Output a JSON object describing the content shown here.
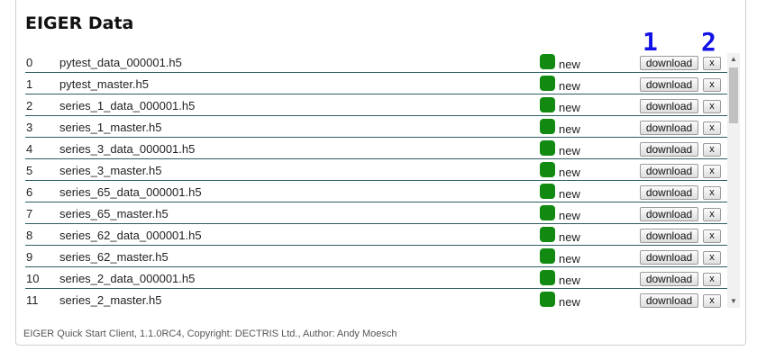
{
  "title": "EIGER Data",
  "markers": [
    "1",
    "2"
  ],
  "buttons": {
    "download_label": "download",
    "delete_label": "x"
  },
  "colors": {
    "status_new": "#128a12",
    "marker": "#1212e8",
    "row_divider": "#2f5d63"
  },
  "files": [
    {
      "index": "0",
      "name": "pytest_data_000001.h5",
      "status": "new"
    },
    {
      "index": "1",
      "name": "pytest_master.h5",
      "status": "new"
    },
    {
      "index": "2",
      "name": "series_1_data_000001.h5",
      "status": "new"
    },
    {
      "index": "3",
      "name": "series_1_master.h5",
      "status": "new"
    },
    {
      "index": "4",
      "name": "series_3_data_000001.h5",
      "status": "new"
    },
    {
      "index": "5",
      "name": "series_3_master.h5",
      "status": "new"
    },
    {
      "index": "6",
      "name": "series_65_data_000001.h5",
      "status": "new"
    },
    {
      "index": "7",
      "name": "series_65_master.h5",
      "status": "new"
    },
    {
      "index": "8",
      "name": "series_62_data_000001.h5",
      "status": "new"
    },
    {
      "index": "9",
      "name": "series_62_master.h5",
      "status": "new"
    },
    {
      "index": "10",
      "name": "series_2_data_000001.h5",
      "status": "new"
    },
    {
      "index": "11",
      "name": "series_2_master.h5",
      "status": "new"
    }
  ],
  "footer": "EIGER Quick Start Client, 1.1.0RC4, Copyright: DECTRIS Ltd., Author: Andy Moesch"
}
